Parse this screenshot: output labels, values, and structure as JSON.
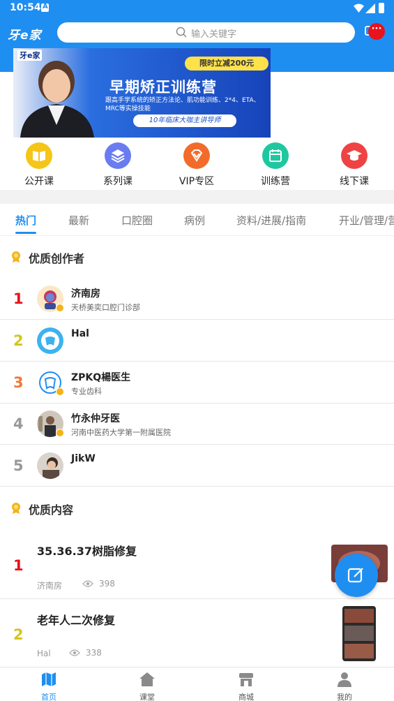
{
  "status_bar": {
    "time": "10:54"
  },
  "header": {
    "logo": "牙e家",
    "search_placeholder": "输入关键字",
    "badge": "···"
  },
  "banner": {
    "brand": "牙e家",
    "tag": "限时立减200元",
    "headline": "早期矫正训练营",
    "subtitle": "跟高手学系统的矫正方法论、肌功能训练、2*4、ETA、MRC等实操技能",
    "pill": "10年临床大咖主讲导师"
  },
  "quick_nav": [
    {
      "label": "公开课",
      "icon": "book-icon",
      "color": "#f5c518"
    },
    {
      "label": "系列课",
      "icon": "layers-icon",
      "color": "#6a7cf0"
    },
    {
      "label": "VIP专区",
      "icon": "diamond-icon",
      "color": "#f26b2a"
    },
    {
      "label": "训练营",
      "icon": "calendar-icon",
      "color": "#1fc7a0"
    },
    {
      "label": "线下课",
      "icon": "graduation-cap-icon",
      "color": "#ef4343"
    }
  ],
  "tabs": [
    "热门",
    "最新",
    "口腔圈",
    "病例",
    "资料/进展/指南",
    "开业/管理/营"
  ],
  "creators_section": {
    "title": "优质创作者"
  },
  "creators": [
    {
      "rank": "1",
      "rank_color": "#e8131c",
      "name": "济南房",
      "desc": "天桥美奕口腔门诊部",
      "verified": true
    },
    {
      "rank": "2",
      "rank_color": "#d4c51c",
      "name": "Hal",
      "desc": "",
      "verified": false
    },
    {
      "rank": "3",
      "rank_color": "#f2763a",
      "name": "ZPKQ楊医生",
      "desc": "专业齿科",
      "verified": true
    },
    {
      "rank": "4",
      "rank_color": "#999999",
      "name": "竹永仲牙医",
      "desc": "河南中医药大学第一附属医院",
      "verified": true
    },
    {
      "rank": "5",
      "rank_color": "#999999",
      "name": "JikW",
      "desc": "",
      "verified": false
    }
  ],
  "content_section": {
    "title": "优质内容"
  },
  "posts": [
    {
      "rank": "1",
      "rank_color": "#e8131c",
      "title": "35.36.37树脂修复",
      "author": "济南房",
      "views": "398"
    },
    {
      "rank": "2",
      "rank_color": "#d4c51c",
      "title": "老年人二次修复",
      "author": "Hal",
      "views": "338"
    }
  ],
  "bottom_nav": [
    {
      "label": "首页",
      "icon": "map-icon"
    },
    {
      "label": "课堂",
      "icon": "home-icon"
    },
    {
      "label": "商城",
      "icon": "store-icon"
    },
    {
      "label": "我的",
      "icon": "user-icon"
    }
  ]
}
